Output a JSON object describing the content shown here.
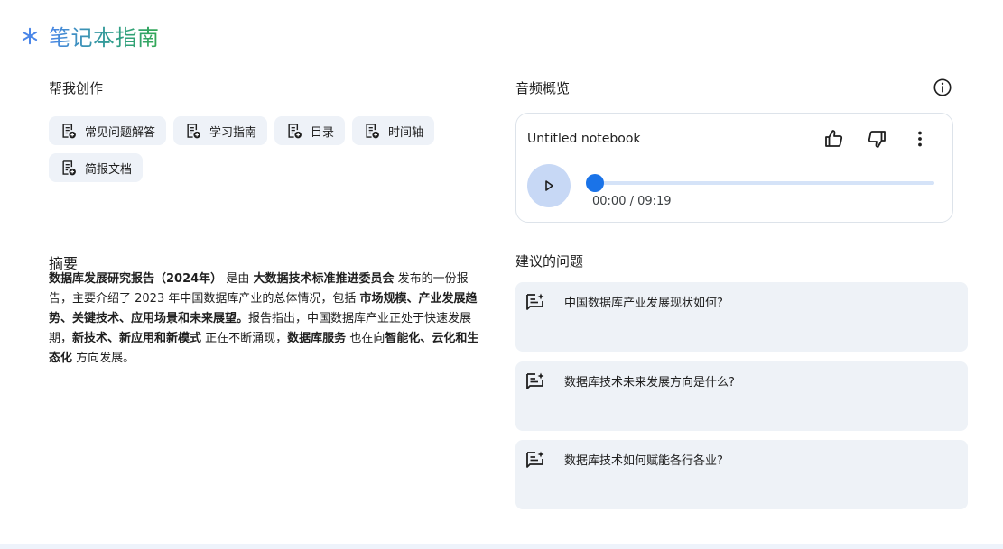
{
  "header": {
    "title": "笔记本指南",
    "icon": "sparkle-icon"
  },
  "create": {
    "label": "帮我创作",
    "chips": [
      [
        "常见问题解答",
        "学习指南",
        "目录",
        "时间轴"
      ],
      [
        "简报文档"
      ]
    ]
  },
  "summary": {
    "label": "摘要",
    "segments": [
      {
        "text": "数据库发展研究报告（2024年）",
        "bold": true
      },
      {
        "text": " 是由 ",
        "bold": false
      },
      {
        "text": "大数据技术标准推进委员会",
        "bold": true
      },
      {
        "text": " 发布的一份报告，主要介绍了 2023 年中国数据库产业的总体情况，包括 ",
        "bold": false
      },
      {
        "text": "市场规模、产业发展趋势、关键技术、应用场景和未来展望。",
        "bold": true
      },
      {
        "text": "报告指出，中国数据库产业正处于快速发展期，",
        "bold": false
      },
      {
        "text": "新技术、新应用和新模式",
        "bold": true
      },
      {
        "text": " 正在不断涌现，",
        "bold": false
      },
      {
        "text": "数据库服务",
        "bold": true
      },
      {
        "text": " 也在向",
        "bold": false
      },
      {
        "text": "智能化、云化和生态化",
        "bold": true
      },
      {
        "text": " 方向发展。",
        "bold": false
      }
    ]
  },
  "audio": {
    "label": "音频概览",
    "title": "Untitled notebook",
    "time": "00:00 / 09:19",
    "progress": 0,
    "accent": "#1a73e8"
  },
  "questions": {
    "label": "建议的问题",
    "items": [
      "中国数据库产业发展现状如何?",
      "数据库技术未来发展方向是什么?",
      "数据库技术如何赋能各行各业?"
    ]
  }
}
